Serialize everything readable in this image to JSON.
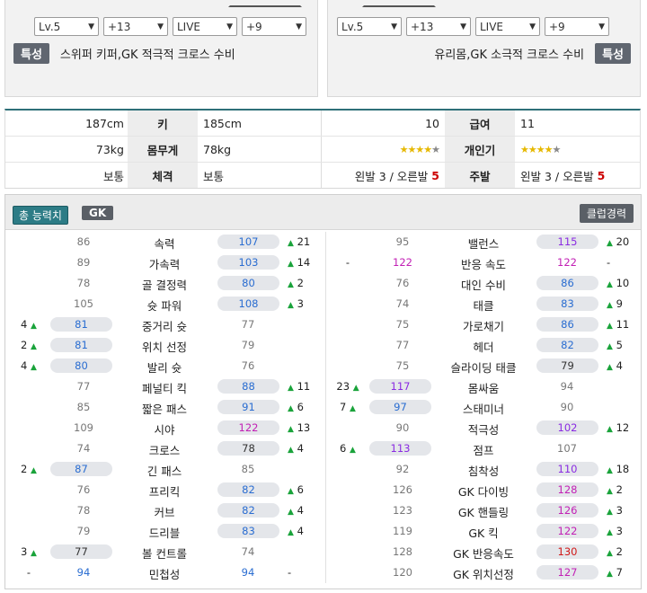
{
  "left_panel": {
    "selects": [
      "Lv.5",
      "+13",
      "LIVE",
      "+9"
    ],
    "trait_label": "특성",
    "trait_text": "스위퍼 키퍼,GK 적극적 크로스 수비"
  },
  "right_panel": {
    "selects": [
      "Lv.5",
      "+13",
      "LIVE",
      "+9"
    ],
    "trait_label": "특성",
    "trait_text": "유리몸,GK 소극적 크로스 수비"
  },
  "info": {
    "height": {
      "left": "187cm",
      "label": "키",
      "right": "185cm"
    },
    "weight": {
      "left": "73kg",
      "label": "몸무게",
      "right": "78kg"
    },
    "build": {
      "left": "보통",
      "label": "체격",
      "right": "보통"
    },
    "salary": {
      "left": "10",
      "label": "급여",
      "right": "11"
    },
    "skill": {
      "label": "개인기",
      "left_stars": 4,
      "right_stars": 4,
      "max_stars": 5
    },
    "foot": {
      "label": "주발",
      "left_text": "왼발 3 / 오른발",
      "left_strong": "5",
      "right_text": "왼발 3 / 오른발",
      "right_strong": "5"
    }
  },
  "stats_header": {
    "total_button": "총 능력치",
    "position_button": "GK",
    "club_button": "클럽경력"
  },
  "colors": {
    "accent": "#2d7c86",
    "up_arrow": "#1aa33b",
    "chip_bg": "#e4e6ea"
  },
  "left_stats": [
    {
      "name": "속력",
      "base": "86",
      "val": "107",
      "diff": "21",
      "side": "right",
      "color": "blue"
    },
    {
      "name": "가속력",
      "base": "89",
      "val": "103",
      "diff": "14",
      "side": "right",
      "color": "blue"
    },
    {
      "name": "골 결정력",
      "base": "78",
      "val": "80",
      "diff": "2",
      "side": "right",
      "color": "blue"
    },
    {
      "name": "슛 파워",
      "base": "105",
      "val": "108",
      "diff": "3",
      "side": "right",
      "color": "blue"
    },
    {
      "name": "중거리 슛",
      "base": "77",
      "val": "81",
      "diff": "4",
      "side": "left",
      "color": "blue"
    },
    {
      "name": "위치 선정",
      "base": "79",
      "val": "81",
      "diff": "2",
      "side": "left",
      "color": "blue"
    },
    {
      "name": "발리 슛",
      "base": "76",
      "val": "80",
      "diff": "4",
      "side": "left",
      "color": "blue"
    },
    {
      "name": "페널티 킥",
      "base": "77",
      "val": "88",
      "diff": "11",
      "side": "right",
      "color": "blue"
    },
    {
      "name": "짧은 패스",
      "base": "85",
      "val": "91",
      "diff": "6",
      "side": "right",
      "color": "blue"
    },
    {
      "name": "시야",
      "base": "109",
      "val": "122",
      "diff": "13",
      "side": "right",
      "color": "magenta"
    },
    {
      "name": "크로스",
      "base": "74",
      "val": "78",
      "diff": "4",
      "side": "right",
      "color": "dark"
    },
    {
      "name": "긴 패스",
      "base": "85",
      "val": "87",
      "diff": "2",
      "side": "left",
      "color": "blue"
    },
    {
      "name": "프리킥",
      "base": "76",
      "val": "82",
      "diff": "6",
      "side": "right",
      "color": "blue"
    },
    {
      "name": "커브",
      "base": "78",
      "val": "82",
      "diff": "4",
      "side": "right",
      "color": "blue"
    },
    {
      "name": "드리블",
      "base": "79",
      "val": "83",
      "diff": "4",
      "side": "right",
      "color": "blue"
    },
    {
      "name": "볼 컨트롤",
      "base": "74",
      "val": "77",
      "diff": "3",
      "side": "left",
      "color": "dark"
    },
    {
      "name": "민첩성",
      "base": "94",
      "val": "94",
      "diff": "-",
      "side": "equal",
      "color": "blue"
    }
  ],
  "right_stats": [
    {
      "name": "밸런스",
      "base": "95",
      "val": "115",
      "diff": "20",
      "side": "right",
      "color": "purple"
    },
    {
      "name": "반응 속도",
      "base": "122",
      "val": "122",
      "diff": "-",
      "side": "equal",
      "color": "magenta"
    },
    {
      "name": "대인 수비",
      "base": "76",
      "val": "86",
      "diff": "10",
      "side": "right",
      "color": "blue"
    },
    {
      "name": "태클",
      "base": "74",
      "val": "83",
      "diff": "9",
      "side": "right",
      "color": "blue"
    },
    {
      "name": "가로채기",
      "base": "75",
      "val": "86",
      "diff": "11",
      "side": "right",
      "color": "blue"
    },
    {
      "name": "헤더",
      "base": "77",
      "val": "82",
      "diff": "5",
      "side": "right",
      "color": "blue"
    },
    {
      "name": "슬라이딩 태클",
      "base": "75",
      "val": "79",
      "diff": "4",
      "side": "right",
      "color": "dark"
    },
    {
      "name": "몸싸움",
      "base": "94",
      "val": "117",
      "diff": "23",
      "side": "left",
      "color": "purple"
    },
    {
      "name": "스태미너",
      "base": "90",
      "val": "97",
      "diff": "7",
      "side": "left",
      "color": "blue"
    },
    {
      "name": "적극성",
      "base": "90",
      "val": "102",
      "diff": "12",
      "side": "right",
      "color": "purple"
    },
    {
      "name": "점프",
      "base": "107",
      "val": "113",
      "diff": "6",
      "side": "left",
      "color": "purple"
    },
    {
      "name": "침착성",
      "base": "92",
      "val": "110",
      "diff": "18",
      "side": "right",
      "color": "purple"
    },
    {
      "name": "GK 다이빙",
      "base": "126",
      "val": "128",
      "diff": "2",
      "side": "right",
      "color": "magenta"
    },
    {
      "name": "GK 핸들링",
      "base": "123",
      "val": "126",
      "diff": "3",
      "side": "right",
      "color": "magenta"
    },
    {
      "name": "GK 킥",
      "base": "119",
      "val": "122",
      "diff": "3",
      "side": "right",
      "color": "magenta"
    },
    {
      "name": "GK 반응속도",
      "base": "128",
      "val": "130",
      "diff": "2",
      "side": "right",
      "color": "crimson"
    },
    {
      "name": "GK 위치선정",
      "base": "120",
      "val": "127",
      "diff": "7",
      "side": "right",
      "color": "magenta"
    }
  ]
}
